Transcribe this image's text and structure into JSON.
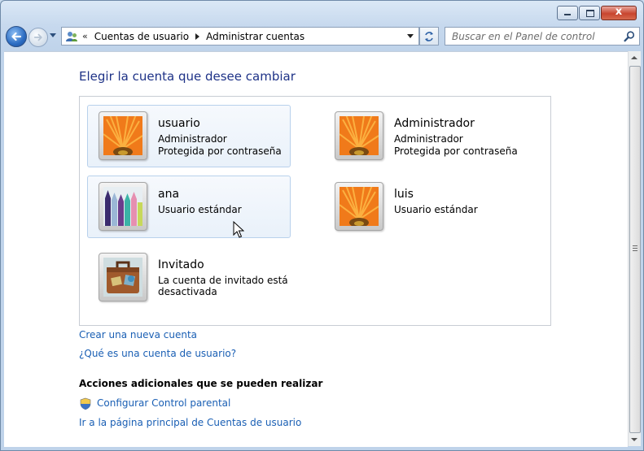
{
  "window": {
    "caption_buttons": [
      "minimize",
      "maximize",
      "close"
    ],
    "close_glyph": "x"
  },
  "nav": {
    "chevron": "«",
    "breadcrumb": [
      "Cuentas de usuario",
      "Administrar cuentas"
    ],
    "search_placeholder": "Buscar en el Panel de control"
  },
  "page": {
    "title": "Elegir la cuenta que desee cambiar",
    "accounts": [
      {
        "name": "usuario",
        "line1": "Administrador",
        "line2": "Protegida por contraseña",
        "picture": "flower",
        "state": "selected"
      },
      {
        "name": "Administrador",
        "line1": "Administrador",
        "line2": "Protegida por contraseña",
        "picture": "flower",
        "state": "normal"
      },
      {
        "name": "ana",
        "line1": "Usuario estándar",
        "line2": "",
        "picture": "crayons",
        "state": "hover"
      },
      {
        "name": "luis",
        "line1": "Usuario estándar",
        "line2": "",
        "picture": "flower",
        "state": "normal"
      },
      {
        "name": "Invitado",
        "line1": "La cuenta de invitado está desactivada",
        "line2": "",
        "picture": "suitcase",
        "state": "normal"
      }
    ],
    "links": {
      "create": "Crear una nueva cuenta",
      "what_is": "¿Qué es una cuenta de usuario?"
    },
    "additional": {
      "heading": "Acciones adicionales que se pueden realizar",
      "parental": "Configurar Control parental",
      "main_page": "Ir a la página principal de Cuentas de usuario"
    }
  },
  "colors": {
    "title_blue": "#1e3287",
    "link_blue": "#1a5fb4",
    "flower_orange": "#f07a1a"
  }
}
